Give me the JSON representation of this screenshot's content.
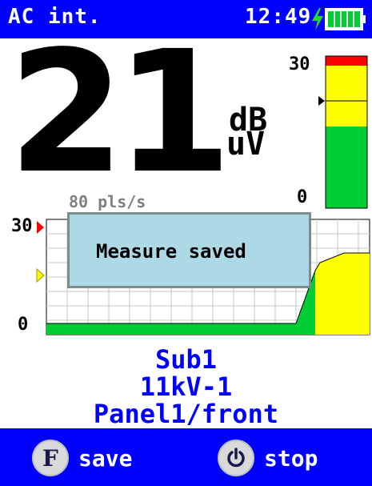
{
  "header": {
    "mode": "AC int.",
    "time": "12:49",
    "charging_icon": "lightning-bolt-icon",
    "battery_icon": "battery-full-icon",
    "bar_color": "#0000ff"
  },
  "reading": {
    "value": "21",
    "unit_top": "dB",
    "unit_bottom": "uV",
    "rate": "80 pls/s"
  },
  "gauge": {
    "max_label": "30",
    "min_label": "0",
    "colors": {
      "high": "#ff0000",
      "mid": "#ffff00",
      "low": "#00cc33"
    }
  },
  "history": {
    "max_label": "30",
    "min_label": "0"
  },
  "dialog": {
    "message": "Measure saved"
  },
  "location": {
    "line1": "Sub1",
    "line2": "11kV-1",
    "line3": "Panel1/front"
  },
  "footer": {
    "left_key": "F",
    "left_label": "save",
    "right_key_icon": "power-icon",
    "right_label": "stop"
  }
}
